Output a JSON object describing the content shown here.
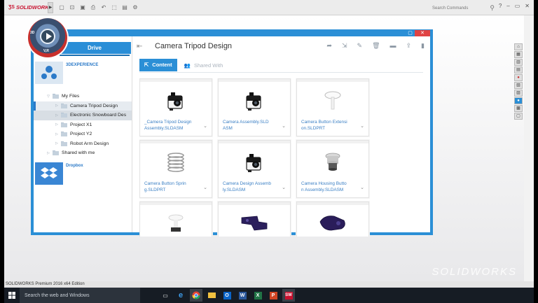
{
  "app": {
    "logo_text": "SOLIDWORKS",
    "search_placeholder": "Search Commands",
    "status_text": "SOLIDWORKS Premium 2016 x64 Edition",
    "watermark": "SOLIDWORKS",
    "help_label": "?"
  },
  "window": {
    "close_label": "✕"
  },
  "sidebar": {
    "drive_label": "Drive",
    "service_3dexperience": "3DEXPERIENCE",
    "service_dropbox": "Dropbox",
    "compass_label": "3D",
    "compass_version": "V,R",
    "tree": [
      {
        "label": "My Files",
        "level": 0,
        "caret": "▽"
      },
      {
        "label": "Camera Tripod Design",
        "level": 1,
        "caret": "▷"
      },
      {
        "label": "Electronic Snowboard Des",
        "level": 1,
        "caret": "▷"
      },
      {
        "label": "Project X1",
        "level": 1,
        "caret": "▷"
      },
      {
        "label": "Project Y2",
        "level": 1,
        "caret": "▷"
      },
      {
        "label": "Robot Arm Design",
        "level": 1,
        "caret": "▷"
      },
      {
        "label": "Shared with me",
        "level": 0,
        "caret": "▷"
      }
    ]
  },
  "main": {
    "title": "Camera Tripod Design",
    "tab_content": "Content",
    "tab_shared": "Shared With",
    "cards": [
      {
        "line1": "_Camera Tripod Design",
        "line2": "Assembly.SLDASM",
        "thumb": "camera-assembly"
      },
      {
        "line1": "Camera Assembly.SLD",
        "line2": "ASM",
        "thumb": "camera-assembly"
      },
      {
        "line1": "Camera Button Extensi",
        "line2": "on.SLDPRT",
        "thumb": "button-extension"
      },
      {
        "line1": "Camera Button Sprin",
        "line2": "g.SLDPRT",
        "thumb": "spring"
      },
      {
        "line1": "Camera Design Assemb",
        "line2": "ly.SLDASM",
        "thumb": "camera-assembly"
      },
      {
        "line1": "Camera Housing Butto",
        "line2": "n Assembly.SLDASM",
        "thumb": "housing-button"
      },
      {
        "line1": "",
        "line2": "",
        "thumb": "knob"
      },
      {
        "line1": "",
        "line2": "",
        "thumb": "bracket"
      },
      {
        "line1": "",
        "line2": "",
        "thumb": "clamp"
      }
    ]
  },
  "taskbar": {
    "search_placeholder": "Search the web and Windows"
  }
}
